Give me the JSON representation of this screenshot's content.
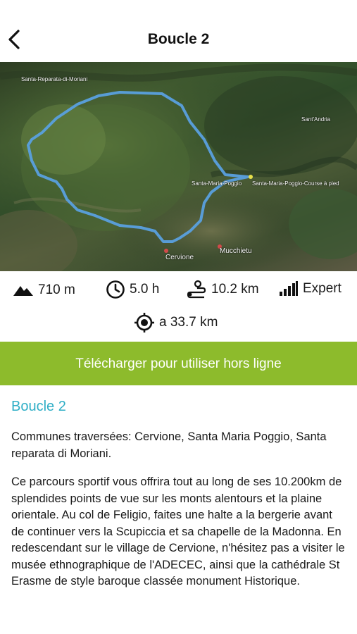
{
  "header": {
    "title": "Boucle 2",
    "back_icon": "chevron-left-icon"
  },
  "map": {
    "labels": {
      "santa_reparata": "Santa-Reparata-di-Moriani",
      "sant_andria": "Sant'Andria",
      "santa_maria_poggio": "Santa-Maria-Poggio",
      "course": "Santa-Maria-Poggio-Course à pied",
      "cervione": "Cervione",
      "mucchietu": "Mucchietu"
    },
    "route_color": "#5aa0df"
  },
  "stats": {
    "elevation": {
      "icon": "mountain-icon",
      "value": "710 m"
    },
    "duration": {
      "icon": "clock-icon",
      "value": "5.0 h"
    },
    "distance": {
      "icon": "route-icon",
      "value": "10.2 km"
    },
    "difficulty": {
      "icon": "signal-bars-icon",
      "value": "Expert"
    },
    "distance_from_me": {
      "icon": "location-target-icon",
      "value": "a 33.7 km"
    }
  },
  "download_button": {
    "label": "Télécharger pour utiliser hors ligne",
    "color": "#8dbb2c"
  },
  "content": {
    "subtitle": "Boucle 2",
    "communes": "Communes traversées: Cervione, Santa Maria Poggio, Santa reparata di Moriani.",
    "description": "Ce parcours sportif vous offrira tout au long de ses 10.200km de splendides points de vue sur les monts alentours et la plaine orientale. Au col de Feligio, faites une halte a la bergerie avant de continuer vers la Scupiccia et sa chapelle de la Madonna. En redescendant sur le village de Cervione, n'hésitez pas a visiter le musée ethnographique de l'ADECEC, ainsi que la cathédrale St Erasme de style baroque classée monument Historique."
  }
}
